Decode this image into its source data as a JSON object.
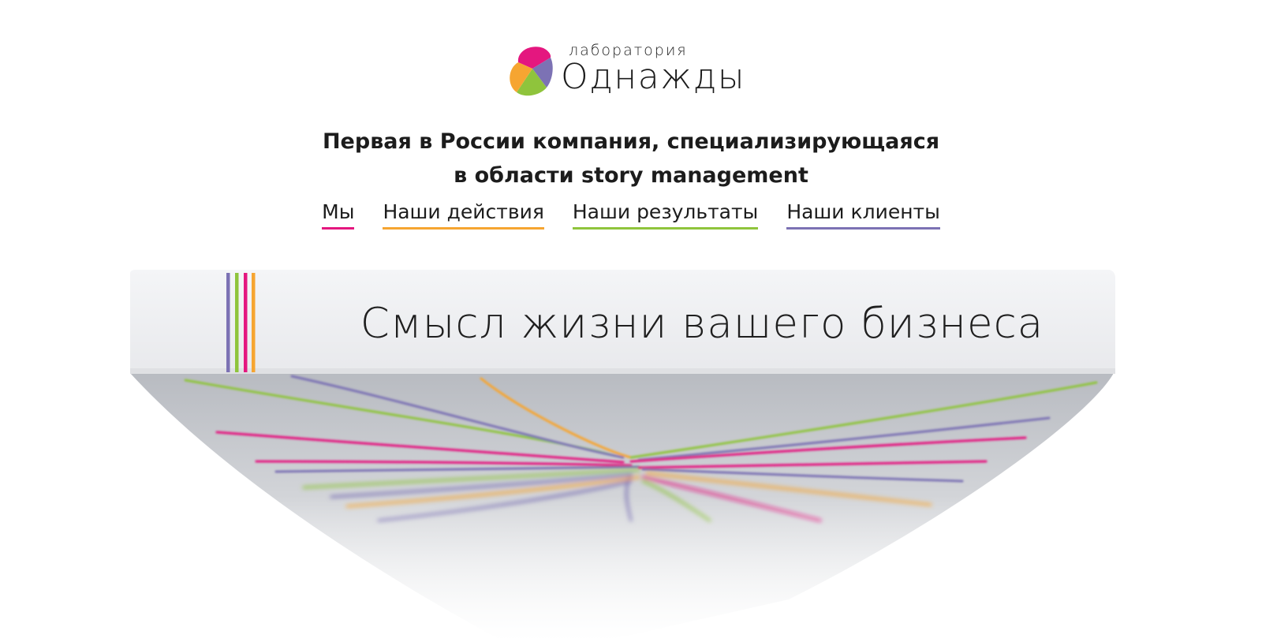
{
  "logo": {
    "small": "лаборатория",
    "big": "Однажды",
    "colors": [
      "#e4177f",
      "#f6a531",
      "#8fc43c",
      "#7c72b4"
    ]
  },
  "tagline": {
    "line1": "Первая в России компания, специализирующаяся",
    "line2": "в области story management"
  },
  "nav": [
    {
      "label": "Мы",
      "color": "#e4177f"
    },
    {
      "label": "Наши действия",
      "color": "#f6a531"
    },
    {
      "label": "Наши результаты",
      "color": "#8fc43c"
    },
    {
      "label": "Наши клиенты",
      "color": "#7c72b4"
    }
  ],
  "book": {
    "title": "Смысл жизни вашего бизнеса",
    "stripe_colors": [
      "#7c72b4",
      "#8fc43c",
      "#e4177f",
      "#f6a531"
    ]
  }
}
